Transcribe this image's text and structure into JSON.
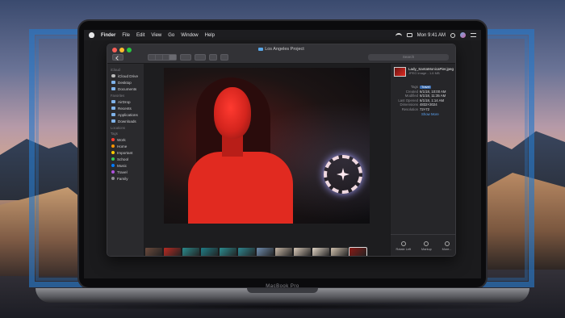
{
  "menubar": {
    "app_name": "Finder",
    "items": [
      "File",
      "Edit",
      "View",
      "Go",
      "Window",
      "Help"
    ],
    "clock": "Mon 9:41 AM"
  },
  "window": {
    "title": "Los Angeles Project",
    "search_placeholder": "Search"
  },
  "sidebar": {
    "sections": [
      {
        "heading": "iCloud",
        "items": [
          {
            "label": "iCloud Drive",
            "icon": "cloud-icon"
          },
          {
            "label": "Desktop",
            "icon": "desktop-folder-icon"
          },
          {
            "label": "Documents",
            "icon": "documents-folder-icon"
          }
        ]
      },
      {
        "heading": "Favorites",
        "items": [
          {
            "label": "AirDrop",
            "icon": "airdrop-icon"
          },
          {
            "label": "Recents",
            "icon": "recents-icon"
          },
          {
            "label": "Applications",
            "icon": "applications-icon"
          },
          {
            "label": "Downloads",
            "icon": "downloads-icon"
          }
        ]
      },
      {
        "heading": "Locations",
        "items": []
      }
    ],
    "tags_heading": "Tags",
    "tags": [
      {
        "label": "Work",
        "color": "#ff3b30"
      },
      {
        "label": "Home",
        "color": "#ff9500"
      },
      {
        "label": "Important",
        "color": "#ffcc00"
      },
      {
        "label": "School",
        "color": "#34c759"
      },
      {
        "label": "Music",
        "color": "#007aff"
      },
      {
        "label": "Travel",
        "color": "#af52de"
      },
      {
        "label": "Family",
        "color": "#8e8e93"
      }
    ]
  },
  "inspector": {
    "file_name": "Lady_SantaMonicaPier.jpeg",
    "file_kind": "JPEG image - 1.6 MB",
    "meta": [
      {
        "key": "Tags",
        "value": "Travel",
        "is_tag": true
      },
      {
        "key": "Created",
        "value": "6/1/18, 10:00 AM"
      },
      {
        "key": "Modified",
        "value": "6/1/18, 11:35 AM"
      },
      {
        "key": "Last Opened",
        "value": "6/1/18, 1:14 AM"
      },
      {
        "key": "Dimensions",
        "value": "4832×3024"
      },
      {
        "key": "Resolution",
        "value": "72×72"
      }
    ],
    "show_more": "Show More",
    "actions": [
      {
        "label": "Rotate Left",
        "icon": "rotate-left-icon"
      },
      {
        "label": "Markup",
        "icon": "markup-icon"
      },
      {
        "label": "More...",
        "icon": "more-icon"
      }
    ]
  },
  "filmstrip": {
    "thumbs": [
      "#6b4a3c",
      "#b92a22",
      "#2a8a8c",
      "#1f7d86",
      "#2b8c90",
      "#2e8690",
      "#6f8cae",
      "#c7b7a6",
      "#d8c8b8",
      "#e0d3c4",
      "#cfc0ad",
      "#8a1a15"
    ],
    "selected_index": 11
  },
  "laptop": {
    "model": "MacBook Pro"
  }
}
